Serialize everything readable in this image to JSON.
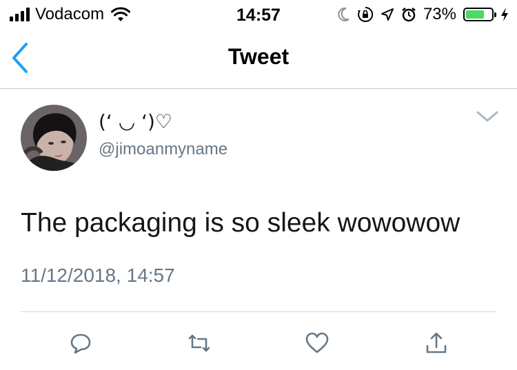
{
  "status_bar": {
    "carrier": "Vodacom",
    "time": "14:57",
    "battery_percent": "73%",
    "battery_level": 0.73,
    "battery_color": "#4cd964",
    "icons": [
      "signal-bars-icon",
      "wifi-icon",
      "moon-icon",
      "rotation-lock-icon",
      "location-arrow-icon",
      "alarm-icon",
      "battery-icon",
      "charging-bolt-icon"
    ]
  },
  "nav": {
    "title": "Tweet",
    "back_icon": "chevron-left-icon",
    "accent_color": "#1da1f2"
  },
  "tweet": {
    "display_name": "(‘ ◡ ‘)♡",
    "handle": "@jimoanmyname",
    "text": "The packaging is so sleek wowowow",
    "timestamp": "11/12/2018, 14:57",
    "menu_icon": "chevron-down-icon"
  },
  "actions": [
    "reply-icon",
    "retweet-icon",
    "like-icon",
    "share-icon"
  ],
  "colors": {
    "text": "#14171a",
    "secondary": "#657786",
    "icon_gray": "#657786"
  }
}
